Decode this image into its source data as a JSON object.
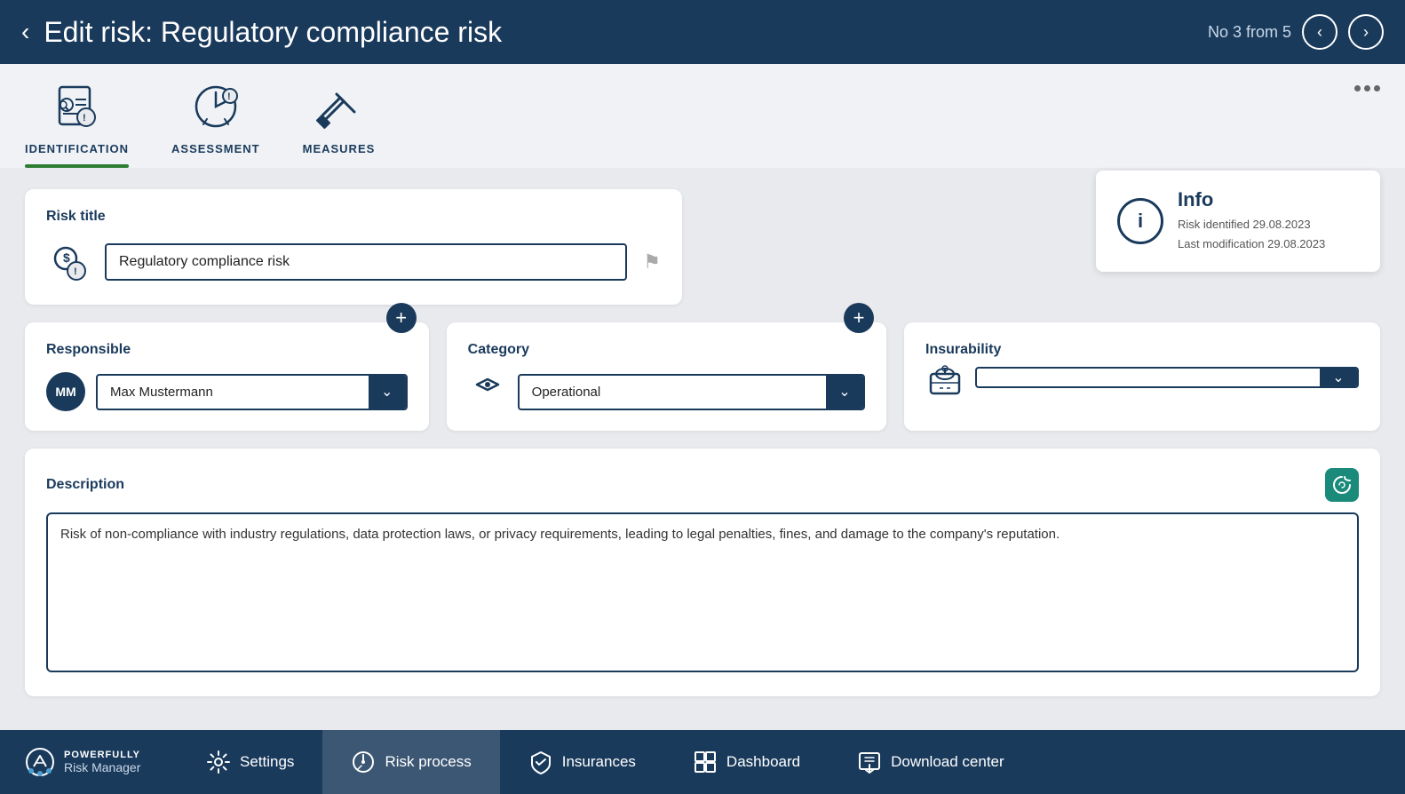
{
  "header": {
    "title": "Edit risk: Regulatory compliance risk",
    "counter": "No 3 from 5",
    "back_label": "‹"
  },
  "tabs": [
    {
      "id": "identification",
      "label": "IDENTIFICATION",
      "active": true
    },
    {
      "id": "assessment",
      "label": "ASSESSMENT",
      "active": false
    },
    {
      "id": "measures",
      "label": "MEASURES",
      "active": false
    }
  ],
  "info_card": {
    "label": "Info",
    "identified": "Risk identified 29.08.2023",
    "modified": "Last modification  29.08.2023"
  },
  "risk_title_section": {
    "label": "Risk title",
    "value": "Regulatory compliance risk"
  },
  "responsible_section": {
    "label": "Responsible",
    "initials": "MM",
    "value": "Max Mustermann"
  },
  "category_section": {
    "label": "Category",
    "value": "Operational"
  },
  "insurability_section": {
    "label": "Insurability",
    "value": ""
  },
  "description_section": {
    "label": "Description",
    "value": "Risk of non-compliance with industry regulations, data protection laws, or privacy requirements, leading to legal penalties, fines, and damage to the company's reputation."
  },
  "bottom_nav": {
    "brand_powerfully": "POWERFULLY",
    "brand_sub": "Risk Manager",
    "settings": "Settings",
    "risk_process": "Risk process",
    "insurances": "Insurances",
    "dashboard": "Dashboard",
    "download_center": "Download center"
  }
}
